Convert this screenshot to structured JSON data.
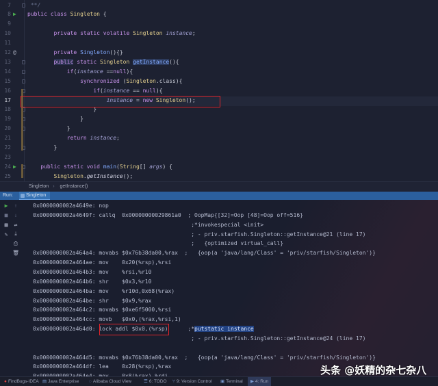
{
  "editor": {
    "lines": [
      {
        "n": "7",
        "t": [
          [
            " **/",
            "cm"
          ]
        ]
      },
      {
        "n": "8",
        "t": [
          [
            "public class ",
            "kw"
          ],
          [
            "Singleton",
            "ty"
          ],
          [
            " {",
            "op"
          ]
        ]
      },
      {
        "n": "9",
        "t": []
      },
      {
        "n": "10",
        "t": [
          [
            "        private static volatile ",
            "kw"
          ],
          [
            "Singleton",
            "ty"
          ],
          [
            " ",
            "op"
          ],
          [
            "instance",
            "fd"
          ],
          [
            ";",
            "op"
          ]
        ]
      },
      {
        "n": "11",
        "t": []
      },
      {
        "n": "12",
        "t": [
          [
            "        private ",
            "kw"
          ],
          [
            "Singleton",
            "mt"
          ],
          [
            "(){}",
            "op"
          ]
        ]
      },
      {
        "n": "13",
        "t": [
          [
            "        ",
            "op"
          ],
          [
            "public",
            "kwb"
          ],
          [
            " static ",
            "kw"
          ],
          [
            "Singleton",
            "ty"
          ],
          [
            " ",
            "op"
          ],
          [
            "getInstance",
            "mtb"
          ],
          [
            "(){",
            "op"
          ]
        ]
      },
      {
        "n": "14",
        "t": [
          [
            "            if",
            "kw"
          ],
          [
            "(",
            "op"
          ],
          [
            "instance",
            "fd"
          ],
          [
            " ==",
            "op"
          ],
          [
            "null",
            "kw"
          ],
          [
            "){",
            "op"
          ]
        ]
      },
      {
        "n": "15",
        "t": [
          [
            "                synchronized ",
            "kw"
          ],
          [
            "(",
            "op"
          ],
          [
            "Singleton",
            "ty"
          ],
          [
            ".class){",
            "op"
          ]
        ]
      },
      {
        "n": "16",
        "t": [
          [
            "                    if",
            "kw"
          ],
          [
            "(",
            "op"
          ],
          [
            "instance",
            "fd"
          ],
          [
            " == ",
            "op"
          ],
          [
            "null",
            "kw"
          ],
          [
            "){",
            "op"
          ]
        ]
      },
      {
        "n": "17",
        "t": [
          [
            "                        ",
            "op"
          ],
          [
            "instance",
            "fd"
          ],
          [
            " = ",
            "op"
          ],
          [
            "new ",
            "kw"
          ],
          [
            "Singleton",
            "ty"
          ],
          [
            "();",
            "op"
          ]
        ]
      },
      {
        "n": "18",
        "t": [
          [
            "                    }",
            "op"
          ]
        ]
      },
      {
        "n": "19",
        "t": [
          [
            "                }",
            "op"
          ]
        ]
      },
      {
        "n": "20",
        "t": [
          [
            "            }",
            "op"
          ]
        ]
      },
      {
        "n": "21",
        "t": [
          [
            "            return ",
            "kw"
          ],
          [
            "instance",
            "fd"
          ],
          [
            ";",
            "op"
          ]
        ]
      },
      {
        "n": "22",
        "t": [
          [
            "        }",
            "op"
          ]
        ]
      },
      {
        "n": "23",
        "t": []
      },
      {
        "n": "24",
        "t": [
          [
            "    public static void ",
            "kw"
          ],
          [
            "main",
            "mt"
          ],
          [
            "(",
            "op"
          ],
          [
            "String",
            "ty"
          ],
          [
            "[] ",
            "op"
          ],
          [
            "args",
            "fd"
          ],
          [
            ") {",
            "op"
          ]
        ]
      },
      {
        "n": "25",
        "t": [
          [
            "        ",
            "op"
          ],
          [
            "Singleton",
            "ty"
          ],
          [
            ".",
            "op"
          ],
          [
            "getInstance",
            "mi"
          ],
          [
            "();",
            "op"
          ]
        ]
      }
    ]
  },
  "breadcrumb": [
    "Singleton",
    "getInstance()"
  ],
  "run_panel": {
    "label": "Run:",
    "tab": "Singleton"
  },
  "console": {
    "lines": [
      [
        "0x0000000002a4649e: nop"
      ],
      [
        "0x0000000002a4649f: callq  0x00000000029861a0  ; OopMap{[32]=Oop [48]=Oop off=516}"
      ],
      [
        "                                                ;*invokespecial <init>"
      ],
      [
        "                                                ; - priv.starfish.Singleton::getInstance@21 (line 17)"
      ],
      [
        "                                                ;   {optimized virtual_call}"
      ],
      [
        "0x0000000002a464a4: movabs $0x76b38da00,%rax  ;   {oop(a 'java/lang/Class' = 'priv/starfish/Singleton')}"
      ],
      [
        "0x0000000002a464ae: mov    0x20(%rsp),%rsi"
      ],
      [
        "0x0000000002a464b3: mov    %rsi,%r10"
      ],
      [
        "0x0000000002a464b6: shr    $0x3,%r10"
      ],
      [
        "0x0000000002a464ba: mov    %r10d,0x68(%rax)"
      ],
      [
        "0x0000000002a464be: shr    $0x9,%rax"
      ],
      [
        "0x0000000002a464c2: movabs $0xe6f5000,%rsi"
      ],
      [
        "0x0000000002a464cc: movb   $0x0,(%rax,%rsi,1)"
      ],
      [
        "0x0000000002a464d0: ",
        "lock addl $0x0,(%rsp)",
        "      ;*",
        "putstatic instance"
      ],
      [
        "                                                ; - priv.starfish.Singleton::getInstance@24 (line 17)"
      ],
      [
        ""
      ],
      [
        "0x0000000002a464d5: movabs $0x76b38da00,%rax  ;   {oop(a 'java/lang/Class' = 'priv/starfish/Singleton')}"
      ],
      [
        "0x0000000002a464df: lea    0x28(%rsp),%rax"
      ],
      [
        "0x0000000002a464e4: mov    0x8(%rax),%rdi"
      ]
    ]
  },
  "status_bar": [
    {
      "label": "FindBugs-IDEA",
      "icon": "bug-icon"
    },
    {
      "label": "Java Enterprise",
      "icon": "java-enterprise-icon"
    },
    {
      "label": "Alibaba Cloud View",
      "icon": "cloud-icon"
    },
    {
      "label": "6: TODO",
      "icon": "todo-icon"
    },
    {
      "label": "9: Version Control",
      "icon": "vcs-icon"
    },
    {
      "label": "Terminal",
      "icon": "terminal-icon"
    },
    {
      "label": "4: Run",
      "icon": "run-icon"
    }
  ],
  "watermark": "头条 @妖精的杂七杂八",
  "colors": {
    "accent": "#2b5f9e",
    "highlight_box": "#e0242a",
    "selection": "#214283"
  }
}
